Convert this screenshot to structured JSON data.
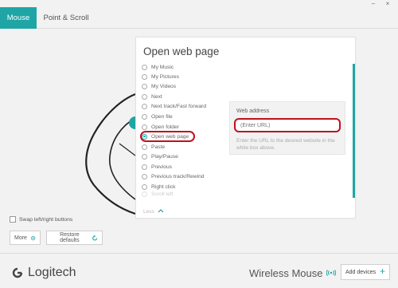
{
  "window": {
    "minimize": "–",
    "close": "×"
  },
  "tabs": [
    {
      "label": "Mouse",
      "active": true
    },
    {
      "label": "Point & Scroll",
      "active": false
    }
  ],
  "panel": {
    "title": "Open web page",
    "options": [
      "My Music",
      "My Pictures",
      "My Videos",
      "Next",
      "Next track/Fast forward",
      "Open file",
      "Open folder",
      "Open web page",
      "Paste",
      "Play/Pause",
      "Previous",
      "Previous track/Rewind",
      "Right click",
      "Scroll left"
    ],
    "selected_option": "Open web page",
    "less_label": "Less"
  },
  "web_address": {
    "label": "Web address",
    "placeholder": "(Enter URL)",
    "help": "Enter the URL to the desired website in the white box above."
  },
  "controls": {
    "swap_label": "Swap left/right buttons",
    "swap_checked": false,
    "more_label": "More",
    "restore_label": "Restore defaults"
  },
  "footer": {
    "brand": "Logitech",
    "device": "Wireless Mouse",
    "add_devices_label": "Add devices"
  },
  "colors": {
    "accent": "#1fa5a5",
    "highlight": "#c0111f"
  },
  "icons": {
    "more": "gear-icon",
    "restore": "refresh-icon",
    "device_status": "wireless-signal-icon",
    "add": "plus-icon",
    "less": "chevron-up-icon"
  }
}
